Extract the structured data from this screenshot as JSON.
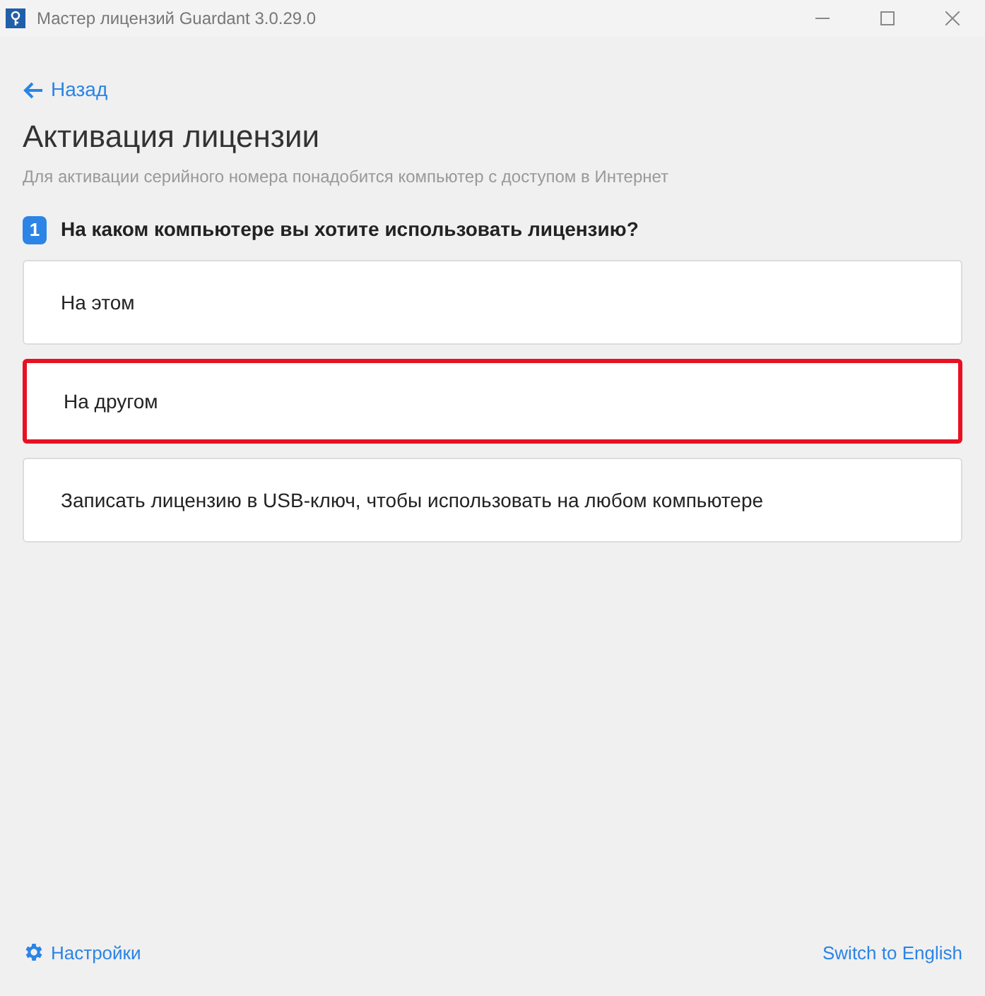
{
  "window": {
    "title": "Мастер лицензий Guardant 3.0.29.0"
  },
  "back_link": "Назад",
  "heading": "Активация лицензии",
  "subtitle": "Для активации серийного номера понадобится компьютер с доступом в Интернет",
  "step": {
    "number": "1",
    "question": "На каком компьютере вы хотите использовать лицензию?"
  },
  "options": [
    {
      "label": "На этом",
      "selected": false
    },
    {
      "label": "На другом",
      "selected": true
    },
    {
      "label": "Записать лицензию в USB-ключ, чтобы использовать на любом компьютере",
      "selected": false
    }
  ],
  "footer": {
    "settings": "Настройки",
    "language": "Switch to English"
  }
}
